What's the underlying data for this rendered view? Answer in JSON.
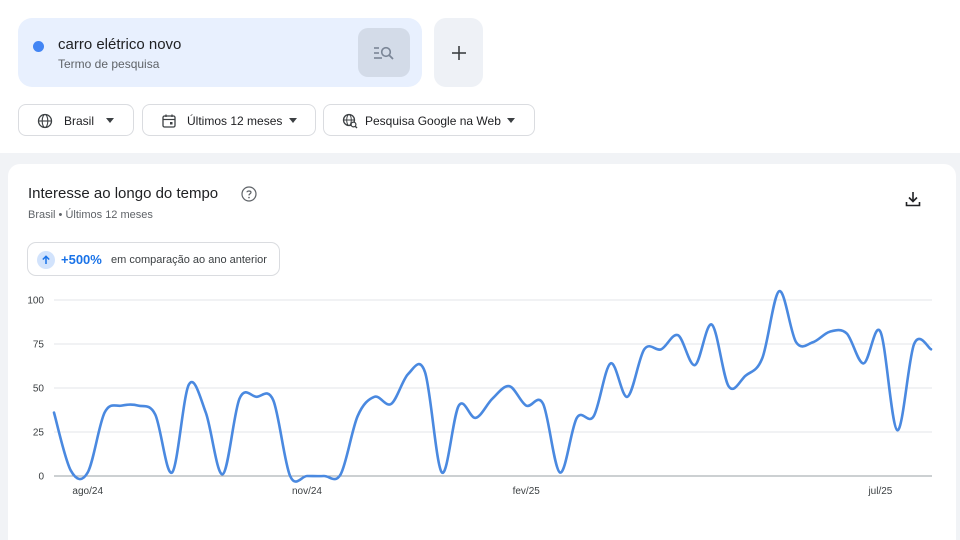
{
  "search_term": {
    "title": "carro elétrico novo",
    "subtitle": "Termo de pesquisa",
    "dot_color": "#4285f4",
    "search_button_icon": "search-list-icon"
  },
  "add_button": {
    "icon": "plus-icon"
  },
  "filters": {
    "region": {
      "label": "Brasil",
      "icon": "globe-icon"
    },
    "period": {
      "label": "Últimos 12 meses",
      "icon": "calendar-icon"
    },
    "source": {
      "label": "Pesquisa Google na Web",
      "icon": "search-web-icon"
    }
  },
  "card": {
    "title": "Interesse ao longo do tempo",
    "subtitle": "Brasil • Últimos 12 meses",
    "help_icon": "help-icon",
    "download_icon": "download-icon",
    "yoy": {
      "value": "+500%",
      "text": "em comparação ao ano anterior",
      "icon": "arrow-up-icon"
    }
  },
  "chart_data": {
    "type": "line",
    "title": "",
    "xlabel": "",
    "ylabel": "",
    "ylim": [
      0,
      100
    ],
    "y_ticks": [
      0,
      25,
      50,
      75,
      100
    ],
    "x_tick_labels": [
      {
        "label": "ago/24",
        "index": 2
      },
      {
        "label": "nov/24",
        "index": 15
      },
      {
        "label": "fev/25",
        "index": 28
      },
      {
        "label": "jul/25",
        "index": 49
      }
    ],
    "grid": true,
    "color": "#4a89e0",
    "series": [
      {
        "values": [
          36,
          3,
          2,
          36,
          40,
          40,
          35,
          2,
          52,
          36,
          1,
          44,
          45,
          43,
          0,
          0,
          0,
          1,
          34,
          45,
          41,
          58,
          59,
          2,
          40,
          33,
          44,
          51,
          40,
          41,
          2,
          33,
          34,
          64,
          45,
          72,
          72,
          80,
          63,
          86,
          51,
          57,
          67,
          105,
          76,
          76,
          82,
          81,
          64,
          82,
          26,
          75,
          72
        ]
      }
    ]
  }
}
